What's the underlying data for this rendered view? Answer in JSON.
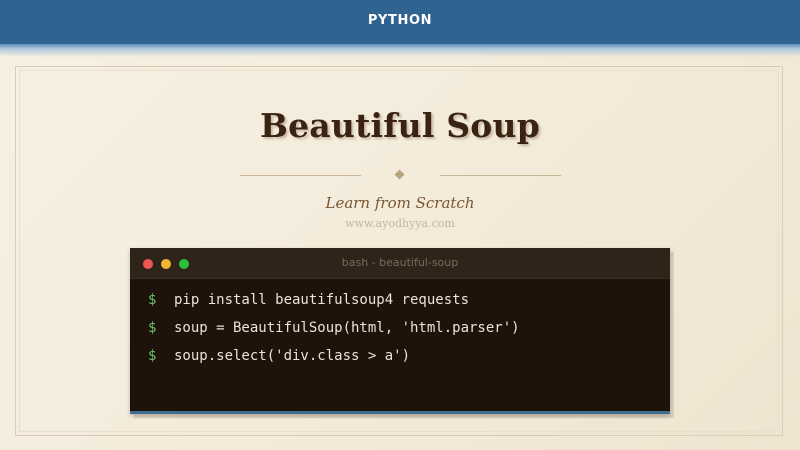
{
  "header": {
    "label": "PYTHON"
  },
  "hero": {
    "title": "Beautiful Soup",
    "subtitle": "Learn from Scratch",
    "website": "www.ayodhyya.com"
  },
  "terminal": {
    "title": "bash - beautiful-soup",
    "prompt": "$",
    "commands": [
      "pip install beautifulsoup4 requests",
      "soup = BeautifulSoup(html, 'html.parser')",
      "soup.select('div.class > a')"
    ]
  },
  "colors": {
    "header_bg": "#2f6390",
    "title_text": "#3a2313",
    "terminal_bg": "#1d130b",
    "prompt_green": "#6ac46a"
  }
}
